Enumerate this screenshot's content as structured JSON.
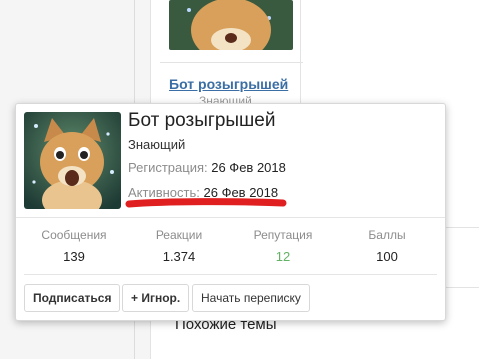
{
  "background": {
    "username_link": "Бот розыгрышей",
    "user_title": "Знающий",
    "similar_threads_heading": "Похожие темы"
  },
  "tooltip": {
    "username": "Бот розыгрышей",
    "user_title": "Знающий",
    "registration_label": "Регистрация:",
    "registration_value": "26 Фев 2018",
    "activity_label": "Активность:",
    "activity_value": "26 Фев 2018",
    "stats": [
      {
        "label": "Сообщения",
        "value": "139"
      },
      {
        "label": "Реакции",
        "value": "1.374"
      },
      {
        "label": "Репутация",
        "value": "12"
      },
      {
        "label": "Баллы",
        "value": "100"
      }
    ],
    "buttons": {
      "subscribe": "Подписаться",
      "ignore": "+ Игнор.",
      "start_conversation": "Начать переписку"
    }
  },
  "colors": {
    "link": "#3a6ea5",
    "reputation_positive": "#63b265",
    "annotation_underline": "#e02020"
  },
  "icons": {
    "avatar": "cat-avatar-icon"
  }
}
